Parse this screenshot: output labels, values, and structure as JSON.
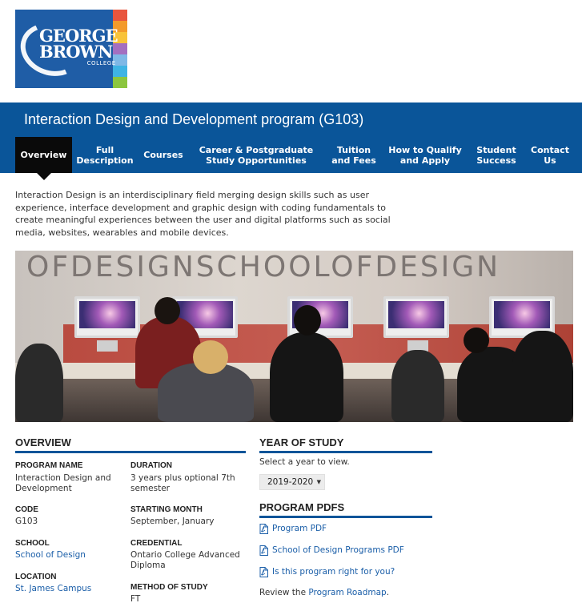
{
  "logo": {
    "line1": "GEORGE",
    "line2": "BROWN",
    "line3": "COLLEGE",
    "stripe_colors": [
      "#e8553e",
      "#f39a2b",
      "#f8c33a",
      "#a46fc0",
      "#7fb8e6",
      "#3fb4e4",
      "#8cc63f"
    ]
  },
  "header": {
    "program_title": "Interaction Design and Development program (G103)",
    "background": "#0a5599"
  },
  "tabs": [
    {
      "label": "Overview",
      "active": true
    },
    {
      "label": "Full Description",
      "active": false
    },
    {
      "label": "Courses",
      "active": false
    },
    {
      "label": "Career & Postgraduate Study Opportunities",
      "active": false
    },
    {
      "label": "Tuition and Fees",
      "active": false
    },
    {
      "label": "How to Qualify and Apply",
      "active": false
    },
    {
      "label": "Student Success",
      "active": false
    },
    {
      "label": "Contact Us",
      "active": false
    }
  ],
  "intro": "Interaction Design is an interdisciplinary field merging design skills such as user experience, interface development and graphic design with coding fundamentals to create meaningful experiences between the user and digital platforms such as social media, websites, wearables and mobile devices.",
  "photo": {
    "wall_text": "OFDESIGNSCHOOLOFDESIGN"
  },
  "overview": {
    "heading": "Overview",
    "fields": {
      "program_name": {
        "label": "Program Name",
        "value": "Interaction Design and Development"
      },
      "duration": {
        "label": "Duration",
        "value": "3 years plus optional 7th semester"
      },
      "code": {
        "label": "Code",
        "value": "G103"
      },
      "starting_month": {
        "label": "Starting Month",
        "value": "September, January"
      },
      "school": {
        "label": "School",
        "value": "School of Design"
      },
      "credential": {
        "label": "Credential",
        "value": "Ontario College Advanced Diploma"
      },
      "location": {
        "label": "Location",
        "value": "St. James Campus"
      },
      "method": {
        "label": "Method of Study",
        "value": "FT"
      }
    }
  },
  "year_of_study": {
    "heading": "Year of Study",
    "instruction": "Select a year to view.",
    "selected": "2019-2020"
  },
  "program_pdfs": {
    "heading": "Program PDFs",
    "links": [
      "Program PDF",
      "School of Design Programs PDF",
      "Is this program right for you?"
    ],
    "roadmap_prefix": "Review the ",
    "roadmap_link": "Program Roadmap",
    "roadmap_suffix": "."
  }
}
